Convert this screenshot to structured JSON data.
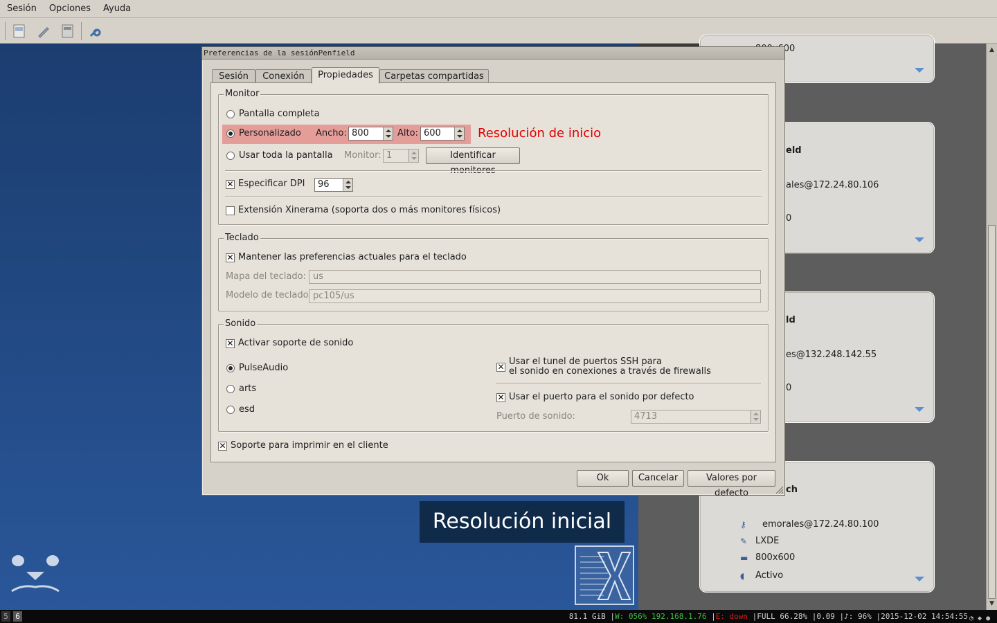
{
  "menubar": {
    "items": [
      {
        "label": "Sesión"
      },
      {
        "label": "Opciones"
      },
      {
        "label": "Ayuda"
      }
    ]
  },
  "dialog": {
    "title": "Preferencias de la sesiónPenfield",
    "tabs": [
      {
        "label": "Sesión"
      },
      {
        "label": "Conexión"
      },
      {
        "label": "Propiedades"
      },
      {
        "label": "Carpetas compartidas"
      }
    ],
    "active_tab": "Propiedades",
    "monitor": {
      "title": "Monitor",
      "fullscreen_label": "Pantalla completa",
      "custom_label": "Personalizado",
      "width_label": "Ancho:",
      "width_value": "800",
      "height_label": "Alto:",
      "height_value": "600",
      "whole_screen_label": "Usar toda la pantalla",
      "monitor_label": "Monitor:",
      "monitor_value": "1",
      "identify_button": "Identificar monitores",
      "dpi_label": "Especificar DPI",
      "dpi_value": "96",
      "xinerama_label": "Extensión Xinerama (soporta dos o más monitores físicos)"
    },
    "keyboard": {
      "title": "Teclado",
      "keep_label": "Mantener las preferencias actuales para el teclado",
      "layout_label": "Mapa del teclado:",
      "layout_value": "us",
      "model_label": "Modelo de teclado:",
      "model_value": "pc105/us"
    },
    "sound": {
      "title": "Sonido",
      "enable_label": "Activar soporte de sonido",
      "pulseaudio_label": "PulseAudio",
      "arts_label": "arts",
      "esd_label": "esd",
      "ssh_tunnel_line1": "Usar el tunel de puertos SSH para",
      "ssh_tunnel_line2": "el sonido en conexiones a través de firewalls",
      "default_port_label": "Usar el puerto para el sonido por defecto",
      "port_label": "Puerto de sonido:",
      "port_value": "4713"
    },
    "print_label": "Soporte para imprimir en el cliente",
    "buttons": {
      "ok": "Ok",
      "cancel": "Cancelar",
      "defaults": "Valores por defecto"
    }
  },
  "annotation": {
    "highlight_label": "Resolución de inicio",
    "caption": "Resolución inicial",
    "highlight_color": "#e59d9a",
    "label_color": "#e00000"
  },
  "sessions": [
    {
      "title": "",
      "lines": [
        "800x600"
      ]
    },
    {
      "title": "eld",
      "lines": [
        "ales@172.24.80.106",
        "0"
      ]
    },
    {
      "title": "ld",
      "lines": [
        "es@132.248.142.55",
        "0"
      ]
    },
    {
      "title": "ch",
      "lines": [
        "emorales@172.24.80.100",
        "LXDE",
        "800x600",
        "Activo"
      ]
    }
  ],
  "statusbar": {
    "workspaces": [
      "5",
      "6"
    ],
    "disk": "81.1 GiB",
    "wifi": "W: 056% 192.168.1.76",
    "eth": "E: down",
    "battery": "FULL 66.28%",
    "load": "0.09",
    "volume": "♪: 96%",
    "datetime": "2015-12-02 14:54:55"
  }
}
